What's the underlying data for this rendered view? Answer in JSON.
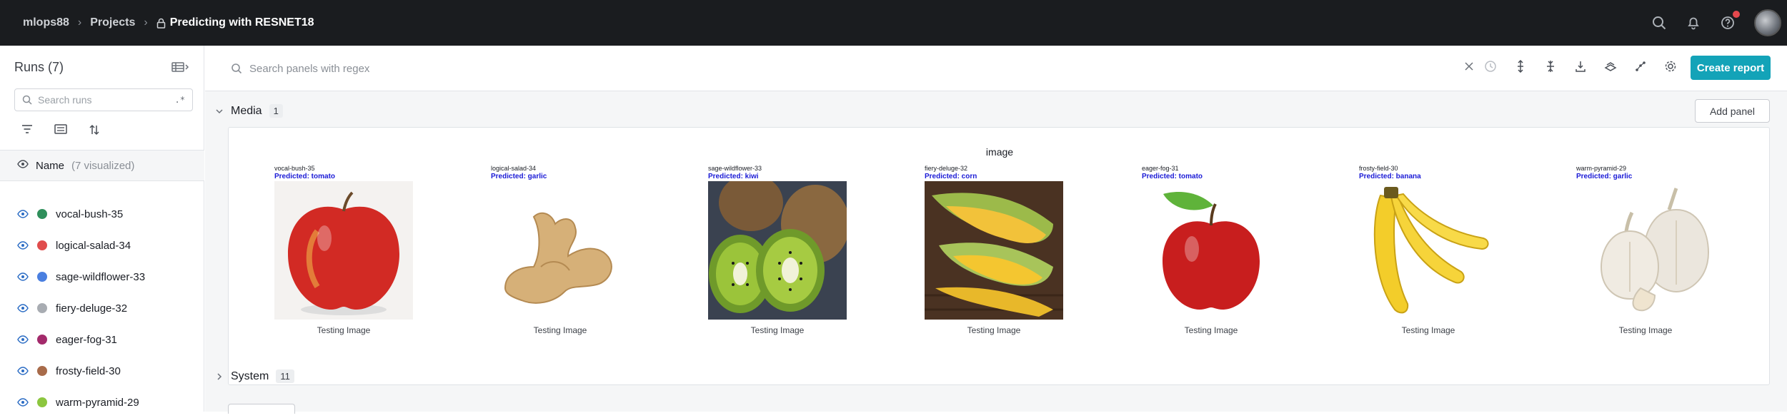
{
  "topbar": {
    "breadcrumb": [
      {
        "label": "mlops88"
      },
      {
        "label": "Projects"
      }
    ],
    "project_title": "Predicting with RESNET18"
  },
  "sidebar": {
    "runs_title": "Runs (7)",
    "search_placeholder": "Search runs",
    "regex_label": ".*",
    "name_header": "Name",
    "name_subheader": "(7 visualized)",
    "runs": [
      {
        "name": "vocal-bush-35",
        "color": "#2f8f5b"
      },
      {
        "name": "logical-salad-34",
        "color": "#e04d4d"
      },
      {
        "name": "sage-wildflower-33",
        "color": "#4a7fe0"
      },
      {
        "name": "fiery-deluge-32",
        "color": "#a8acb2"
      },
      {
        "name": "eager-fog-31",
        "color": "#a32a6b"
      },
      {
        "name": "frosty-field-30",
        "color": "#a86b4a"
      },
      {
        "name": "warm-pyramid-29",
        "color": "#8cc63f"
      }
    ]
  },
  "main": {
    "search_placeholder": "Search panels with regex",
    "create_report_label": "Create report",
    "add_panel_label": "Add panel",
    "media_section": {
      "title": "Media",
      "count": "1"
    },
    "system_section": {
      "title": "System",
      "count": "11"
    },
    "card_title": "image",
    "images": [
      {
        "run": "vocal-bush-35",
        "predicted": "Predicted: tomato",
        "caption": "Testing Image",
        "subject": "apple"
      },
      {
        "run": "logical-salad-34",
        "predicted": "Predicted: garlic",
        "caption": "Testing Image",
        "subject": "ginger"
      },
      {
        "run": "sage-wildflower-33",
        "predicted": "Predicted: kiwi",
        "caption": "Testing Image",
        "subject": "kiwi"
      },
      {
        "run": "fiery-deluge-32",
        "predicted": "Predicted: corn",
        "caption": "Testing Image",
        "subject": "corn"
      },
      {
        "run": "eager-fog-31",
        "predicted": "Predicted: tomato",
        "caption": "Testing Image",
        "subject": "apple"
      },
      {
        "run": "frosty-field-30",
        "predicted": "Predicted: banana",
        "caption": "Testing Image",
        "subject": "banana"
      },
      {
        "run": "warm-pyramid-29",
        "predicted": "Predicted: garlic",
        "caption": "Testing Image",
        "subject": "garlic"
      }
    ]
  }
}
